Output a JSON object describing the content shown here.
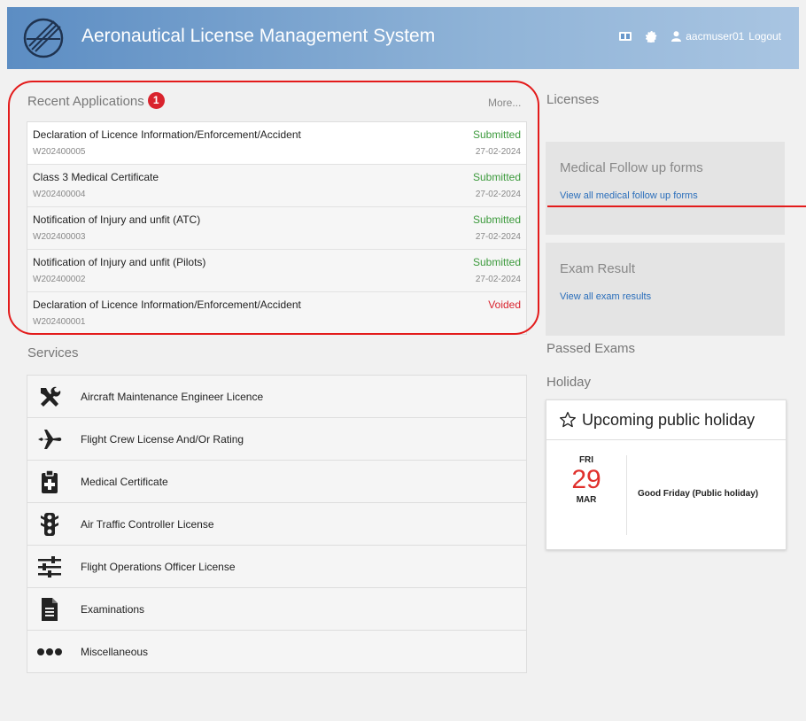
{
  "header": {
    "app_title": "Aeronautical License Management System",
    "username": "aacmuser01",
    "logout_label": "Logout",
    "brand_color": "#6a99cc"
  },
  "recent": {
    "title": "Recent Applications",
    "count": "1",
    "more_label": "More...",
    "items": [
      {
        "name": "Declaration of Licence Information/Enforcement/Accident",
        "id": "W202400005",
        "status": "Submitted",
        "date": "27-02-2024"
      },
      {
        "name": "Class 3 Medical Certificate",
        "id": "W202400004",
        "status": "Submitted",
        "date": "27-02-2024"
      },
      {
        "name": "Notification of Injury and unfit (ATC)",
        "id": "W202400003",
        "status": "Submitted",
        "date": "27-02-2024"
      },
      {
        "name": "Notification of Injury and unfit (Pilots)",
        "id": "W202400002",
        "status": "Submitted",
        "date": "27-02-2024"
      },
      {
        "name": "Declaration of Licence Information/Enforcement/Accident",
        "id": "W202400001",
        "status": "Voided",
        "date": ""
      }
    ]
  },
  "services": {
    "title": "Services",
    "items": [
      {
        "label": "Aircraft Maintenance Engineer Licence",
        "icon": "tools-icon"
      },
      {
        "label": "Flight Crew License And/Or Rating",
        "icon": "plane-icon"
      },
      {
        "label": "Medical Certificate",
        "icon": "clipboard-medical-icon"
      },
      {
        "label": "Air Traffic Controller License",
        "icon": "traffic-light-icon"
      },
      {
        "label": "Flight Operations Officer License",
        "icon": "sliders-icon"
      },
      {
        "label": "Examinations",
        "icon": "document-icon"
      },
      {
        "label": "Miscellaneous",
        "icon": "ellipsis-icon"
      }
    ]
  },
  "right": {
    "licenses_title": "Licenses",
    "medical_title": "Medical Follow up forms",
    "medical_link": "View all medical follow up forms",
    "exam_title": "Exam Result",
    "exam_link": "View all exam results",
    "passed_title": "Passed Exams",
    "holiday_title": "Holiday"
  },
  "holiday": {
    "card_title": "Upcoming public holiday",
    "dow": "FRI",
    "day": "29",
    "month": "MAR",
    "name": "Good Friday (Public holiday)"
  },
  "colors": {
    "submitted": "#3c9a3c",
    "voided": "#d9232d",
    "link": "#2a6ebb",
    "annotation": "#e31b1b"
  }
}
